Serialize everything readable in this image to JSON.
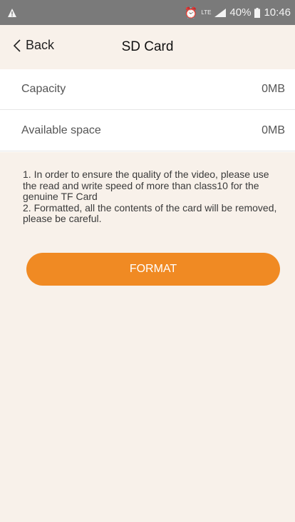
{
  "status_bar": {
    "alarm_icon": "alarm-icon",
    "network": "LTE",
    "battery": "40%",
    "time": "10:46"
  },
  "nav": {
    "back_label": "Back",
    "title": "SD Card"
  },
  "info": {
    "capacity": {
      "label": "Capacity",
      "value": "0MB"
    },
    "available": {
      "label": "Available space",
      "value": "0MB"
    }
  },
  "notes": {
    "line1": "1. In order to ensure the quality of the video, please use the read and write speed of more than class10 for the genuine TF Card",
    "line2": "2. Formatted, all the contents of the card will be removed, please be careful."
  },
  "actions": {
    "format_label": "FORMAT"
  },
  "colors": {
    "accent": "#f08a23",
    "background": "#f8f1ea",
    "status_bar": "#7a7a7a"
  }
}
